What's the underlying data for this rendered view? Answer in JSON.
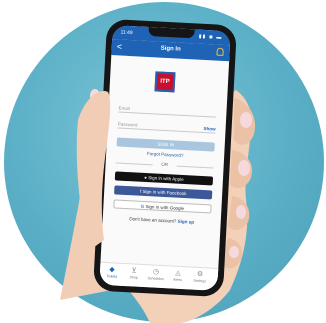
{
  "status": {
    "time": "11:49",
    "icons": "▮▮ ◉ ▬"
  },
  "nav": {
    "back": "<",
    "title": "Sign In"
  },
  "logo": {
    "text": "ITP"
  },
  "form": {
    "email_placeholder": "Email",
    "password_placeholder": "Password",
    "show_label": "Show",
    "signin_label": "SIGN IN",
    "forgot_label": "Forgot Password?",
    "or_label": "OR",
    "apple_label": "Sign in with Apple",
    "facebook_label": "Sign in with Facebook",
    "google_label": "Sign in with Google",
    "account_text": "Don't have an account?",
    "signup_label": "Sign up"
  },
  "tabs": [
    {
      "label": "Tickets"
    },
    {
      "label": "Shop"
    },
    {
      "label": "Schedules"
    },
    {
      "label": "Alerts"
    },
    {
      "label": "Settings"
    }
  ],
  "colors": {
    "brand_blue": "#1e63b5",
    "logo_red": "#c8102e",
    "background": "#5aafc6"
  }
}
